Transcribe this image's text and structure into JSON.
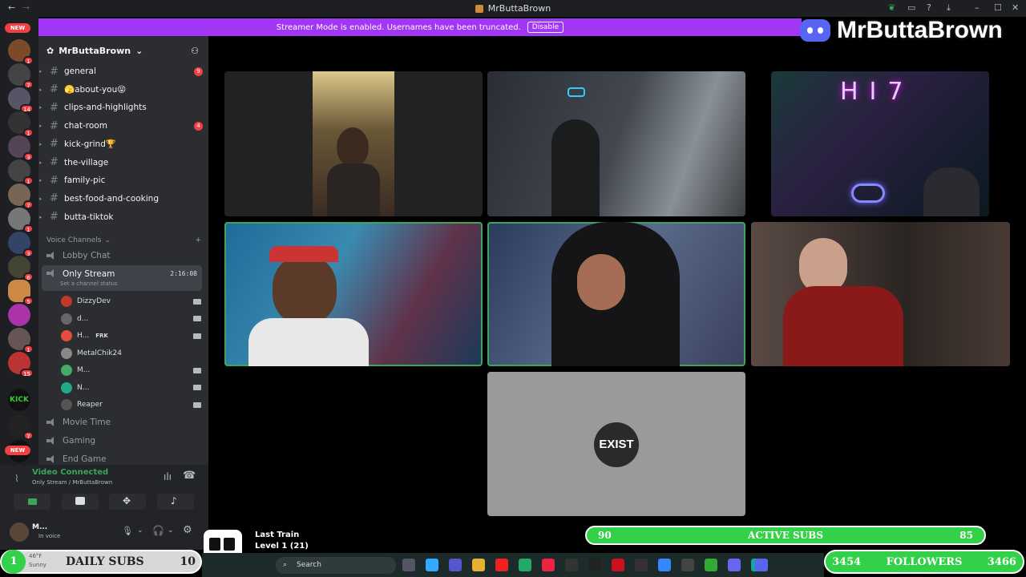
{
  "window": {
    "title": "MrButtaBrown"
  },
  "banner": {
    "text": "Streamer Mode is enabled. Usernames have been truncated.",
    "button": "Disable"
  },
  "brand": {
    "name": "MrButtaBrown"
  },
  "rail": {
    "new_label": "NEW",
    "badges": [
      "1",
      "7",
      "14",
      "1",
      "3",
      "1",
      "7",
      "1",
      "3",
      "6",
      "5",
      "1",
      "6",
      "1",
      "15",
      "1",
      "7"
    ],
    "new_bottom": "NEW"
  },
  "server": {
    "name": "MrButtaBrown"
  },
  "channels": [
    {
      "name": "general",
      "badge": "9"
    },
    {
      "name": "🫣about-you😝",
      "badge": ""
    },
    {
      "name": "clips-and-highlights",
      "badge": ""
    },
    {
      "name": "chat-room",
      "badge": "4"
    },
    {
      "name": "kick-grind🏆",
      "badge": ""
    },
    {
      "name": "the-village",
      "badge": ""
    },
    {
      "name": "family-pic",
      "badge": ""
    },
    {
      "name": "best-food-and-cooking",
      "badge": ""
    },
    {
      "name": "butta-tiktok",
      "badge": ""
    }
  ],
  "voice": {
    "header": "Voice Channels",
    "lobby": "Lobby Chat",
    "stream_channel": "Only Stream",
    "stream_status": "Set a channel status",
    "timer": "2:16:08",
    "members": [
      {
        "name": "DizzyDev",
        "extra": "",
        "color": "#c0392b"
      },
      {
        "name": "d...",
        "extra": "",
        "color": "#666"
      },
      {
        "name": "H...",
        "extra": "FRK",
        "color": "#e74c3c"
      },
      {
        "name": "MetalChik24",
        "extra": "",
        "color": "#888"
      },
      {
        "name": "M...",
        "extra": "",
        "color": "#4a6"
      },
      {
        "name": "N...",
        "extra": "",
        "color": "#2a8"
      },
      {
        "name": "Reaper",
        "extra": "",
        "color": "#555"
      }
    ],
    "others": [
      "Movie Time",
      "Gaming",
      "End Game"
    ]
  },
  "panel": {
    "status": "Video Connected",
    "sub": "Only Stream / MrButtaBrown",
    "user": "M...",
    "user_status": "In voice"
  },
  "tile_logo": "EXIST",
  "song": {
    "label": "Last Train",
    "level": "Level 1 (21)"
  },
  "overlay": {
    "active_left": "90",
    "active_label": "ACTIVE SUBS",
    "active_right": "85",
    "daily_count": "1",
    "daily_label": "DAILY SUBS",
    "daily_right": "10",
    "foll_left": "3454",
    "foll_label": "FOLLOWERS",
    "foll_right": "3466"
  },
  "taskbar": {
    "search": "Search",
    "weather": "46°F",
    "weather_sub": "Sunny"
  }
}
